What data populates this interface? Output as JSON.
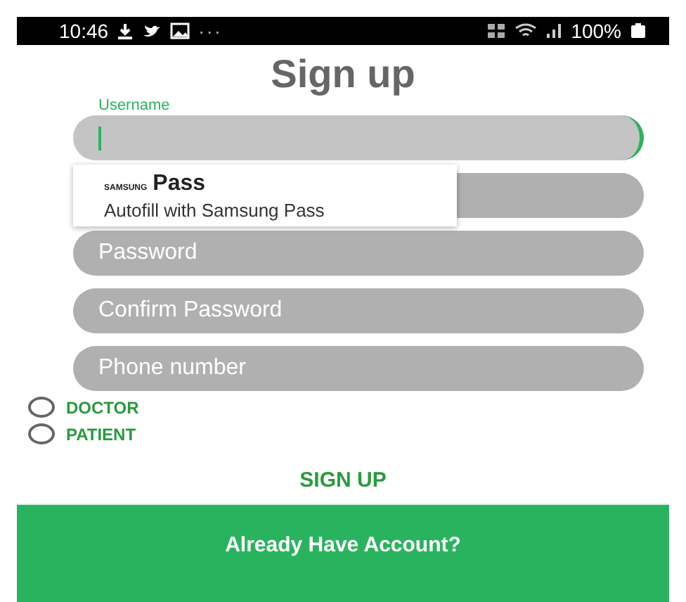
{
  "status_bar": {
    "time": "10:46",
    "more": "···",
    "battery": "100%"
  },
  "title": "Sign up",
  "fields": [
    {
      "label": "Username",
      "focused": true
    },
    {
      "focused": false
    },
    {
      "placeholder": "Password",
      "focused": false
    },
    {
      "placeholder": "Confirm Password",
      "focused": false
    },
    {
      "placeholder": "Phone number",
      "focused": false
    }
  ],
  "autofill_popup": {
    "brand_small": "SAMSUNG",
    "brand_large": "Pass",
    "action": "Autofill with Samsung Pass"
  },
  "roles": [
    {
      "label": "DOCTOR",
      "selected": false
    },
    {
      "label": "PATIENT",
      "selected": false
    }
  ],
  "sign_up_button": "SIGN UP",
  "login_button": "Already Have Account?"
}
